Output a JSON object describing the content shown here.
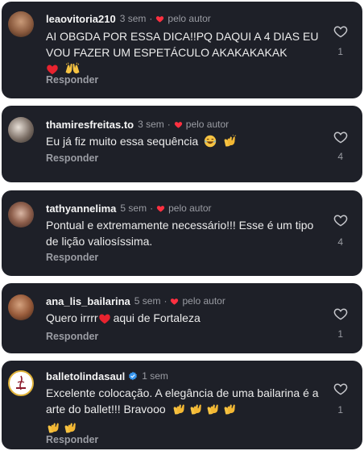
{
  "comments": [
    {
      "username": "leaovitoria210",
      "time": "3 sem",
      "separator": "·",
      "author_label": "pelo autor",
      "text": "AI OBGDA POR ESSA DICA!!PQ DAQUI A 4 DIAS EU VOU FAZER UM ESPETÁCULO AKAKAKAKAK",
      "reply_label": "Responder",
      "likes": "1"
    },
    {
      "username": "thamiresfreitas.to",
      "time": "3 sem",
      "separator": "·",
      "author_label": "pelo autor",
      "text": "Eu já fiz muito essa sequência",
      "reply_label": "Responder",
      "likes": "4"
    },
    {
      "username": "tathyannelima",
      "time": "5 sem",
      "separator": "·",
      "author_label": "pelo autor",
      "text": "Pontual e extremamente necessário!!! Esse é um tipo de lição valiosíssima.",
      "reply_label": "Responder",
      "likes": "4"
    },
    {
      "username": "ana_lis_bailarina",
      "time": "5 sem",
      "separator": "·",
      "author_label": "pelo autor",
      "text_before": "Quero irrrr",
      "text_after": "aqui de Fortaleza",
      "reply_label": "Responder",
      "likes": "1"
    },
    {
      "username": "balletolindasaul",
      "time": "1 sem",
      "text": "Excelente colocação. A elegância de uma bailarina é a arte do ballet!!! Bravooo",
      "reply_label": "Responder",
      "likes": "1"
    }
  ],
  "colors": {
    "card_background": "#1e2028",
    "author_heart": "#ff3040",
    "verified_badge": "#3897f0",
    "muted_text": "#9a9ca3"
  }
}
